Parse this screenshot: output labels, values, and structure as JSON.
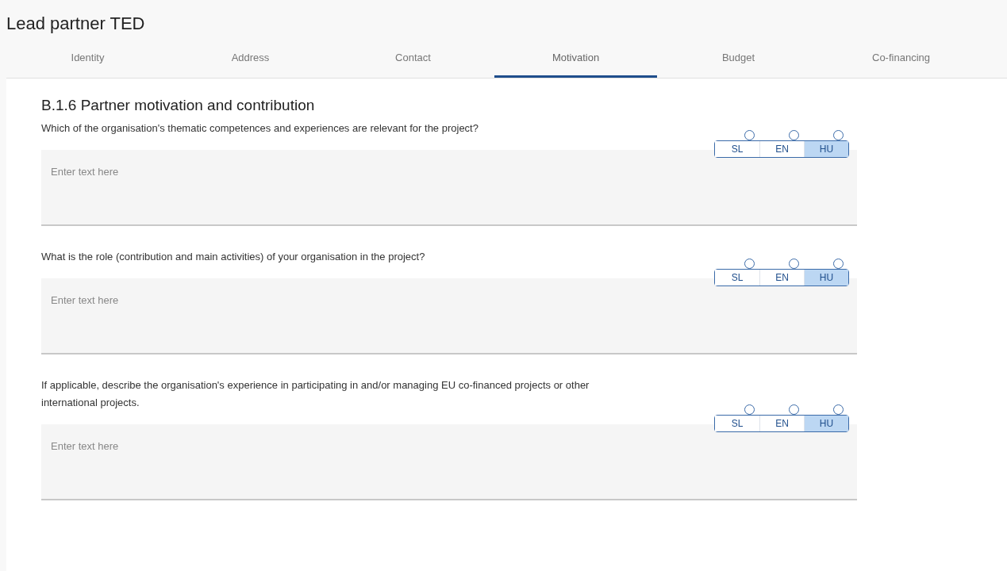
{
  "title": "Lead partner TED",
  "tabs": [
    {
      "label": "Identity",
      "selected": false
    },
    {
      "label": "Address",
      "selected": false
    },
    {
      "label": "Contact",
      "selected": false
    },
    {
      "label": "Motivation",
      "selected": true
    },
    {
      "label": "Budget",
      "selected": false
    },
    {
      "label": "Co-financing",
      "selected": false
    }
  ],
  "section": {
    "heading": "B.1.6 Partner motivation and contribution",
    "questions": [
      {
        "text": "Which of the organisation's thematic competences and experiences are relevant for the project?",
        "languages": [
          {
            "label": "SL",
            "selected": false
          },
          {
            "label": "EN",
            "selected": false
          },
          {
            "label": "HU",
            "selected": true
          }
        ],
        "placeholder": "Enter text here"
      },
      {
        "text": "What is the role (contribution and main activities) of your organisation in the project?",
        "languages": [
          {
            "label": "SL",
            "selected": false
          },
          {
            "label": "EN",
            "selected": false
          },
          {
            "label": "HU",
            "selected": true
          }
        ],
        "placeholder": "Enter text here"
      },
      {
        "text": "If applicable, describe the organisation's experience in participating in and/or managing EU co-financed projects or other international projects.",
        "languages": [
          {
            "label": "SL",
            "selected": false
          },
          {
            "label": "EN",
            "selected": false
          },
          {
            "label": "HU",
            "selected": true
          }
        ],
        "placeholder": "Enter text here"
      }
    ]
  }
}
